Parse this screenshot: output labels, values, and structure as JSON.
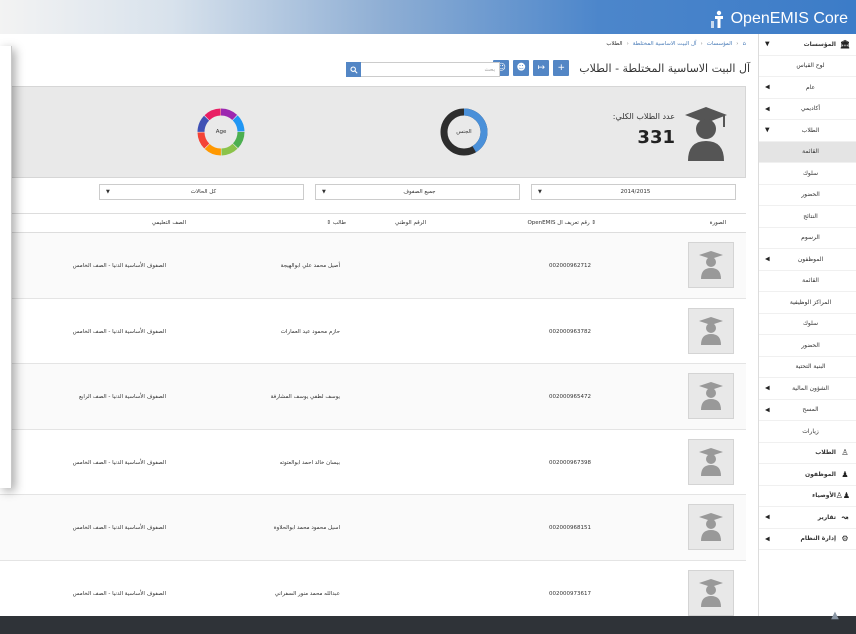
{
  "brand": {
    "name": "OpenEMIS Core"
  },
  "breadcrumb": {
    "home_icon": "home-icon",
    "items": [
      "المؤسسات",
      "آل البيت الاساسية المختلطة",
      "الطلاب"
    ]
  },
  "page": {
    "title": "آل البيت الاساسية المختلطة - الطلاب"
  },
  "search": {
    "placeholder": "بحث"
  },
  "stats": {
    "total_label": "عدد الطلاب الكلي:",
    "total_value": "331",
    "gender_label": "الجنس",
    "age_label": "Age"
  },
  "filters": {
    "year": "2014/2015",
    "grades": "جميع الصفوف",
    "status": "كل الحالات"
  },
  "table": {
    "headers": {
      "photo": "الصورة",
      "openemis_id": "رقم تعريف ال OpenEMIS",
      "national_id": "الرقم الوطني",
      "student": "طالب",
      "grade": "الصف التعليمي"
    },
    "rows": [
      {
        "openemis_id": "002000962712",
        "student": "أصيل محمد علي ابوالهيجة",
        "grade": "الصفوف الأساسية الدنيا - الصف الخامس"
      },
      {
        "openemis_id": "002000963782",
        "student": "حازم محمود عيد العمارات",
        "grade": "الصفوف الأساسية الدنيا - الصف الخامس"
      },
      {
        "openemis_id": "002000965472",
        "student": "يوسف لطفي يوسف المشارفة",
        "grade": "الصفوف الأساسية الدنيا - الصف الرابع"
      },
      {
        "openemis_id": "002000967398",
        "student": "بيسان خالد احمد ابوالعتوته",
        "grade": "الصفوف الأساسية الدنيا - الصف الخامس"
      },
      {
        "openemis_id": "002000968151",
        "student": "اسيل محمود محمد ابوالحلاوة",
        "grade": "الصفوف الأساسية الدنيا - الصف الخامس"
      },
      {
        "openemis_id": "002000973617",
        "student": "عبدالله محمد منور السفراني",
        "grade": "الصفوف الأساسية الدنيا - الصف الخامس"
      }
    ]
  },
  "sidebar": {
    "items": [
      {
        "label": "المؤسسات",
        "icon": "institution-icon",
        "caret": true,
        "bold": true
      },
      {
        "label": "لوح القياس",
        "center": true
      },
      {
        "label": "عام",
        "center": true,
        "caret": true
      },
      {
        "label": "أكاديمي",
        "center": true,
        "caret": true
      },
      {
        "label": "الطلاب",
        "center": true,
        "caret": true
      },
      {
        "label": "القائمة",
        "center": true,
        "active": true
      },
      {
        "label": "سلوك",
        "center": true
      },
      {
        "label": "الحضور",
        "center": true
      },
      {
        "label": "النتائج",
        "center": true
      },
      {
        "label": "الرسوم",
        "center": true
      },
      {
        "label": "الموظفون",
        "center": true,
        "caret": true
      },
      {
        "label": "القائمة",
        "center": true
      },
      {
        "label": "المراكز الوظيفية",
        "center": true
      },
      {
        "label": "سلوك",
        "center": true
      },
      {
        "label": "الحضور",
        "center": true
      },
      {
        "label": "البنية التحتية",
        "center": true
      },
      {
        "label": "الشؤون المالية",
        "center": true,
        "caret": true
      },
      {
        "label": "المسح",
        "center": true,
        "caret": true
      },
      {
        "label": "زيارات",
        "center": true
      },
      {
        "label": "الطلاب",
        "icon": "student-icon",
        "bold": true
      },
      {
        "label": "الموظفون",
        "icon": "staff-icon",
        "bold": true
      },
      {
        "label": "الأوصياء",
        "icon": "guardians-icon",
        "bold": true
      },
      {
        "label": "تقارير",
        "icon": "reports-icon",
        "caret": true,
        "bold": true
      },
      {
        "label": "إدارة النظام",
        "icon": "settings-icon",
        "caret": true,
        "bold": true
      }
    ]
  },
  "colors": {
    "accent": "#5386c5",
    "donut_gender_male": "#4a90d9",
    "donut_gender_female": "#2d2d2d",
    "donut_age": [
      "#9c27b0",
      "#2196f3",
      "#4caf50",
      "#8bc34a",
      "#ff9800",
      "#f44336",
      "#3f51b5",
      "#e91e63"
    ]
  }
}
